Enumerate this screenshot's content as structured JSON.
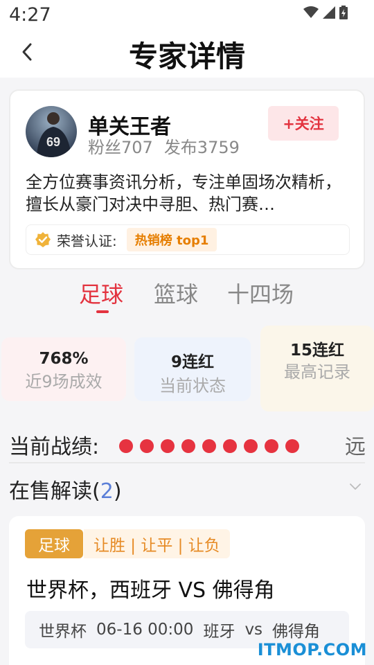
{
  "status_bar": {
    "time": "4:27"
  },
  "header": {
    "title": "专家详情"
  },
  "expert": {
    "name": "单关王者",
    "fans": "粉丝707",
    "posts": "发布3759",
    "follow_label": "+关注",
    "intro": "全方位赛事资讯分析，专注单固场次精析，擅长从豪门对决中寻胆、热门赛…",
    "honor_label": "荣誉认证:",
    "honor_tag": "热销榜 top1",
    "avatar_jersey_number": "69"
  },
  "sport_tabs": [
    {
      "label": "足球",
      "active": true
    },
    {
      "label": "篮球",
      "active": false
    },
    {
      "label": "十四场",
      "active": false
    }
  ],
  "stats": [
    {
      "value": "768%",
      "label": "近9场成效"
    },
    {
      "value": "9连红",
      "label": "当前状态"
    },
    {
      "value": "15连红",
      "label": "最高记录"
    }
  ],
  "record": {
    "label": "当前战绩:",
    "results": [
      "red",
      "red",
      "red",
      "red",
      "red",
      "red",
      "red",
      "red",
      "red"
    ],
    "far_label": "远"
  },
  "on_sale": {
    "label": "在售解读",
    "count": "2"
  },
  "match": {
    "sport": "足球",
    "bet_types": "让胜 | 让平 | 让负",
    "title": "世界杯，西班牙 VS 佛得角",
    "league": "世界杯",
    "datetime": "06-16 00:00",
    "home": "班牙",
    "vs": "vs",
    "away": "佛得角"
  },
  "watermark": "ITMOP.COM",
  "colors": {
    "accent": "#e3333f",
    "gold": "#e5a238",
    "blue": "#5b7fd8",
    "win_dot": "#e63340"
  }
}
